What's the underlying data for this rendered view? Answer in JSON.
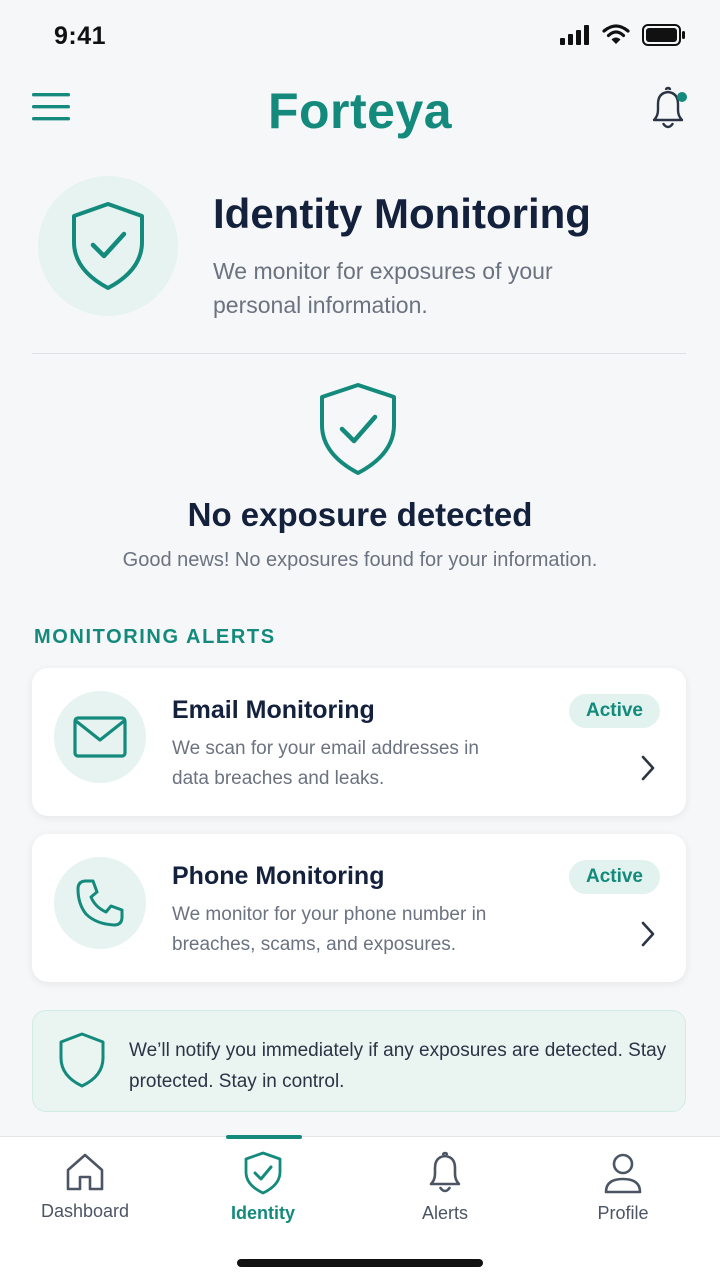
{
  "status_bar": {
    "time": "9:41",
    "icons": [
      "cellular-signal-icon",
      "wifi-icon",
      "battery-icon"
    ]
  },
  "header": {
    "brand": "Forteya",
    "menu_icon": "hamburger-menu-icon",
    "notification_icon": "bell-icon",
    "has_unread": true
  },
  "hero": {
    "icon": "shield-check-icon",
    "title": "Identity Monitoring",
    "subtitle": "We monitor for exposures of your personal information."
  },
  "status": {
    "icon": "shield-check-icon",
    "title": "No exposure detected",
    "description": "Good news! No exposures found for your information."
  },
  "alerts_section": {
    "title": "MONITORING ALERTS",
    "cards": [
      {
        "icon": "envelope-icon",
        "title": "Email Monitoring",
        "description": "We scan for your email addresses in data breaches and leaks.",
        "badge": "Active"
      },
      {
        "icon": "phone-icon",
        "title": "Phone Monitoring",
        "description": "We monitor for your phone number in breaches, scams, and exposures.",
        "badge": "Active"
      }
    ]
  },
  "info_banner": {
    "icon": "shield-icon",
    "text": "We’ll notify you immediately if any exposures are detected. Stay protected. Stay in control."
  },
  "bottom_nav": {
    "active": "Identity",
    "items": [
      {
        "label": "Dashboard",
        "icon": "home-icon"
      },
      {
        "label": "Identity",
        "icon": "shield-check-icon"
      },
      {
        "label": "Alerts",
        "icon": "bell-icon"
      },
      {
        "label": "Profile",
        "icon": "person-icon"
      }
    ]
  },
  "colors": {
    "accent": "#138a7b",
    "accent_light": "#e6f3f0",
    "text_primary": "#14213d",
    "text_secondary": "#6b7280",
    "background": "#f6f7f8"
  }
}
